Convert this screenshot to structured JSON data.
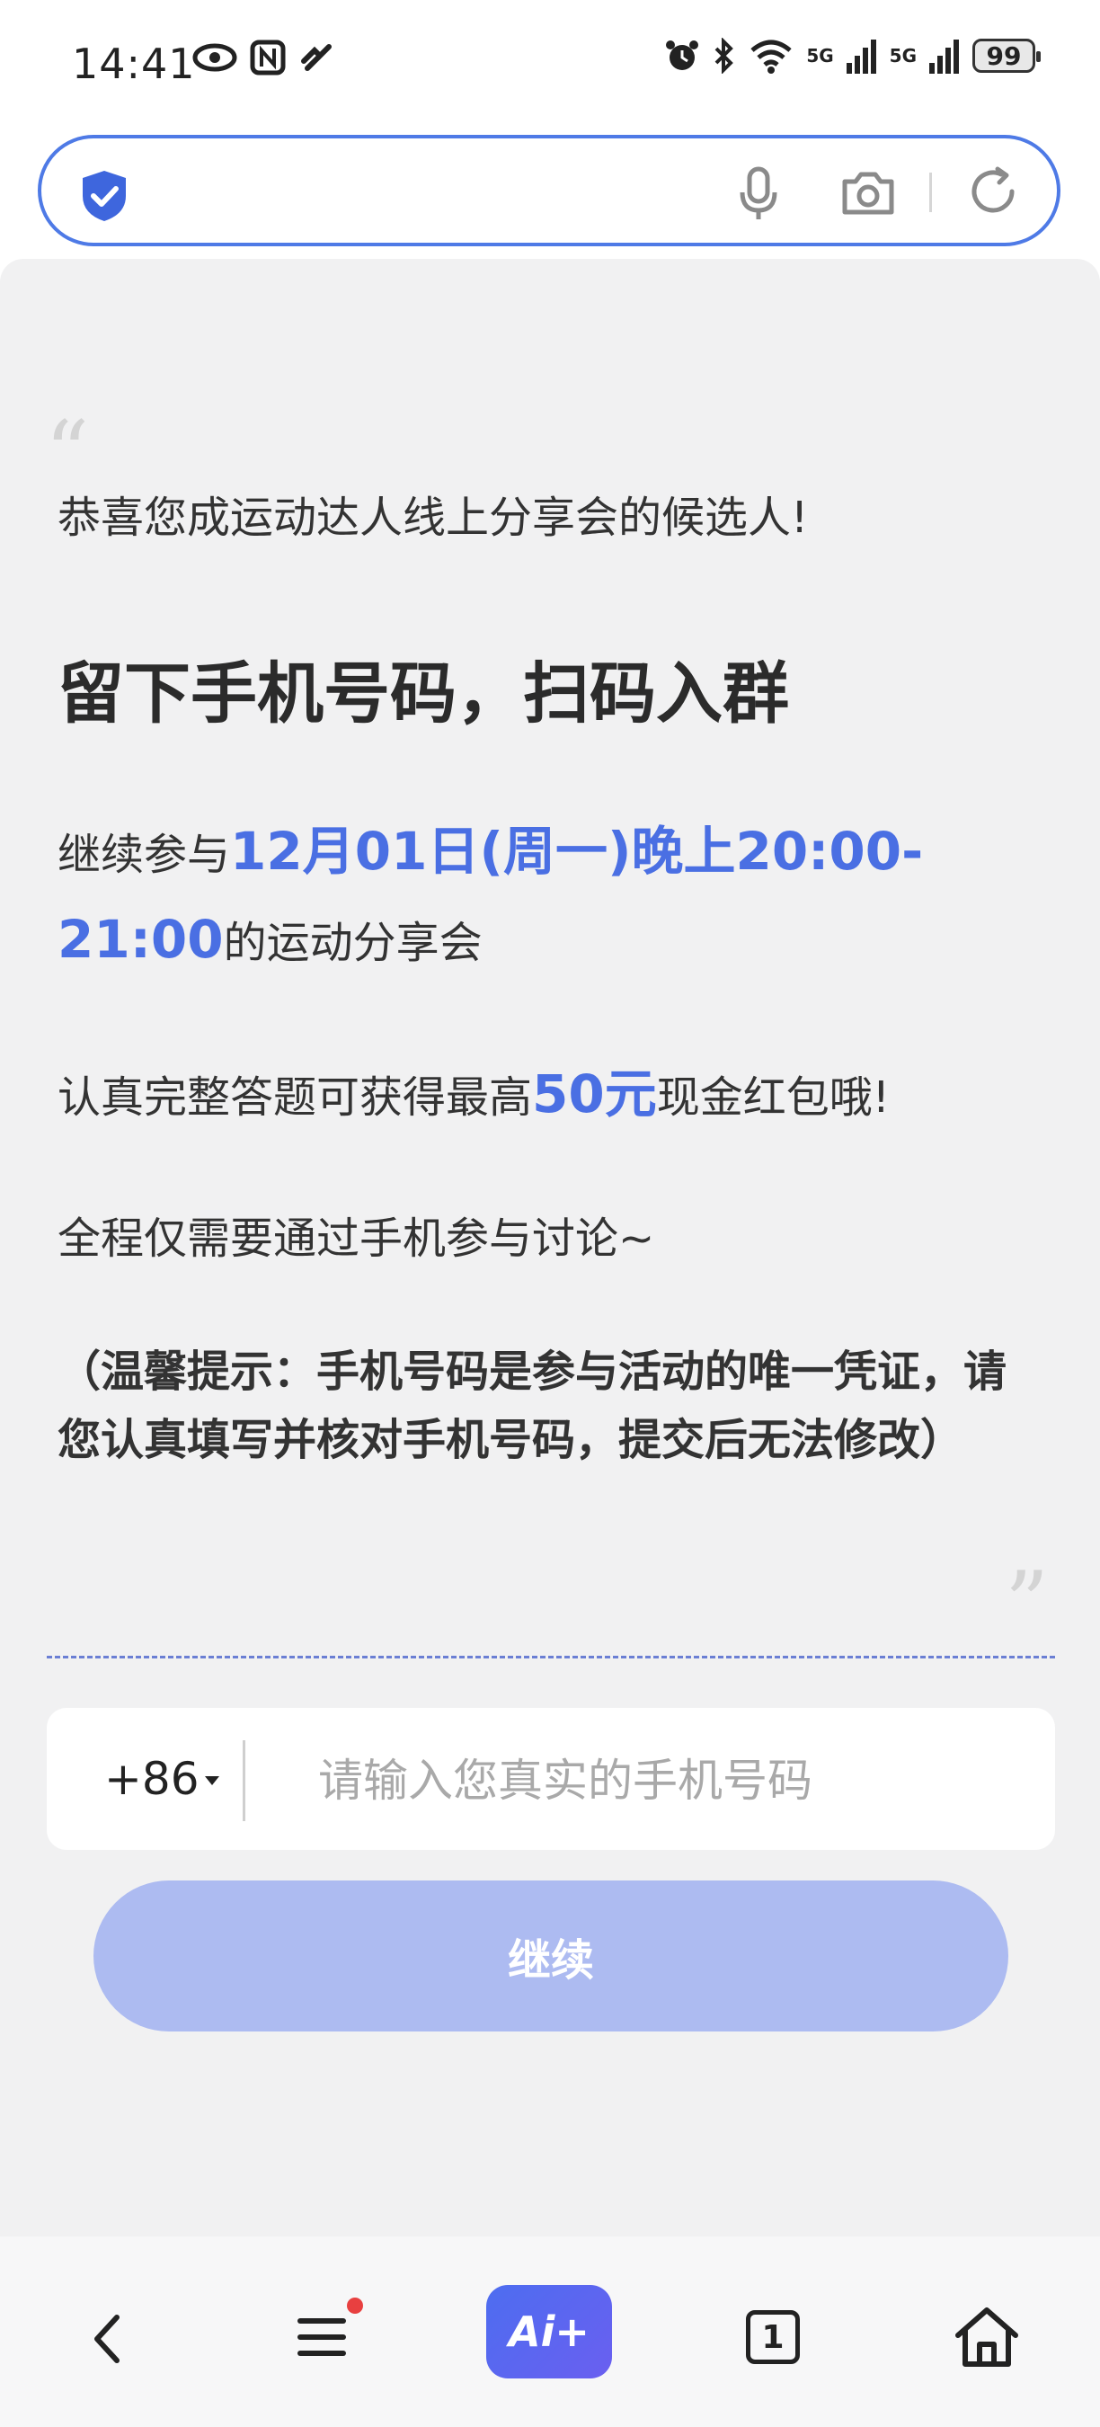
{
  "status_bar": {
    "time": "14:41",
    "signal_1": "5G",
    "signal_2": "5G",
    "battery": "99",
    "left_icons": [
      "eye-icon",
      "nfc-icon",
      "link-icon"
    ],
    "right_icons": [
      "alarm-icon",
      "bluetooth-icon",
      "wifi-icon",
      "signal-icon",
      "signal-icon",
      "battery-icon"
    ]
  },
  "search_bar": {
    "value": "",
    "icons": [
      "shield-check-icon",
      "microphone-icon",
      "camera-icon",
      "reload-icon"
    ]
  },
  "content": {
    "intro": "恭喜您成运动达人线上分享会的候选人!",
    "heading": "留下手机号码，扫码入群",
    "line1_pre": "继续参与",
    "line1_highlight": "12月01日(周一)晚上20:00-21:00",
    "line1_post": "的运动分享会",
    "line2_pre": "认真完整答题可获得最高",
    "line2_highlight": "50元",
    "line2_post": "现金红包哦!",
    "line3": "全程仅需要通过手机参与讨论~",
    "tip": "（温馨提示：手机号码是参与活动的唯一凭证，请您认真填写并核对手机号码，提交后无法修改）",
    "quote_open": "“",
    "quote_close": "”"
  },
  "form": {
    "country_code": "+86",
    "phone_placeholder": "请输入您真实的手机号码",
    "phone_value": "",
    "continue_label": "继续"
  },
  "bottom_nav": {
    "ai_label": "Ai+",
    "tab_count": "1",
    "icons": [
      "back-icon",
      "menu-icon",
      "ai-icon",
      "tabs-icon",
      "home-icon"
    ]
  },
  "colors": {
    "accent": "#4a6fe3",
    "button": "#adbbf1",
    "page_bg": "#f1f1f2",
    "search_border": "#4e7ae6"
  }
}
